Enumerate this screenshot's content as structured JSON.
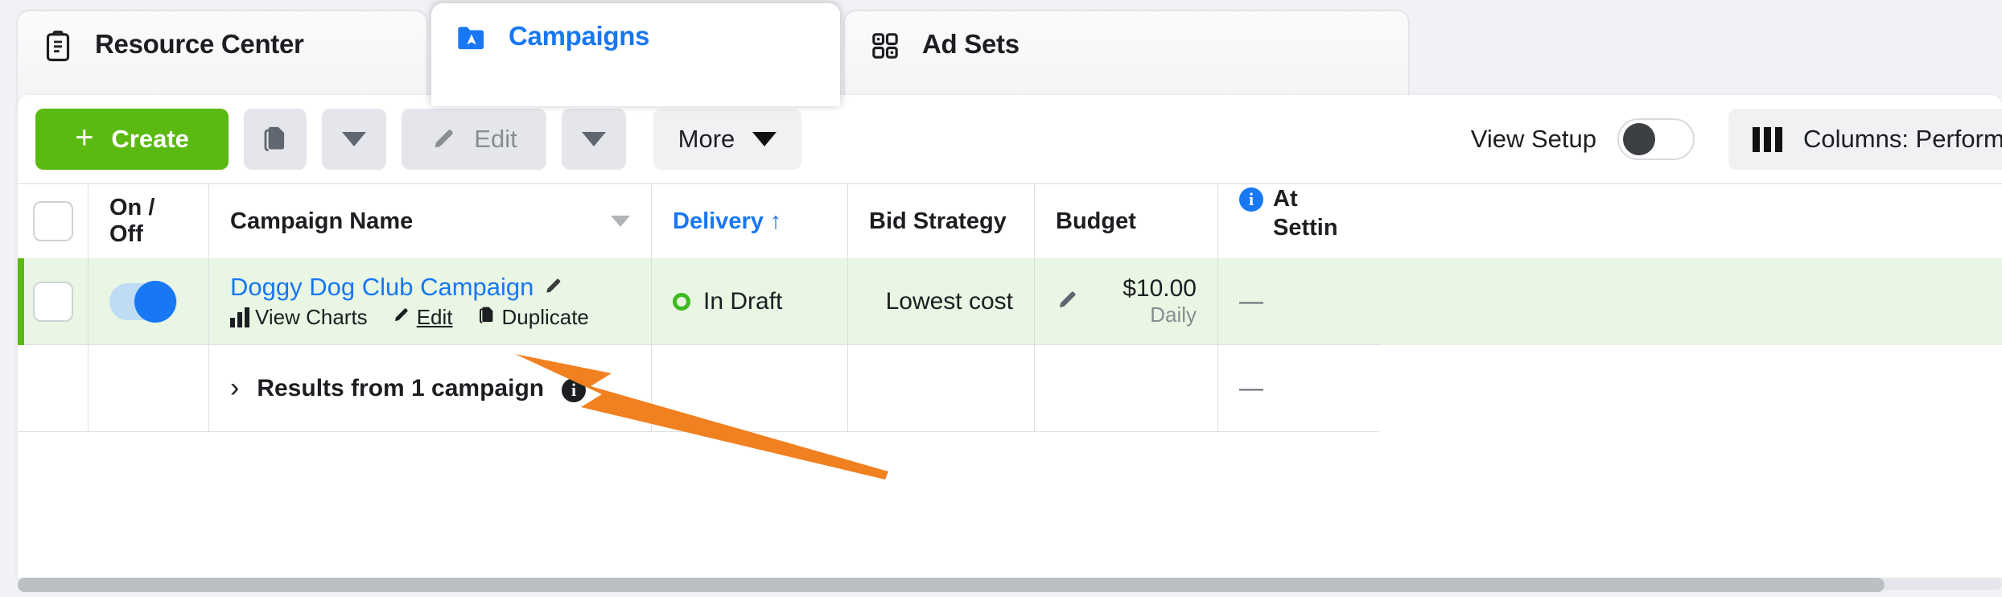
{
  "tabs": [
    {
      "label": "Resource Center",
      "icon": "clipboard-icon",
      "active": false
    },
    {
      "label": "Campaigns",
      "icon": "campaign-folder-icon",
      "active": true
    },
    {
      "label": "Ad Sets",
      "icon": "grid-squares-icon",
      "active": false
    }
  ],
  "toolbar": {
    "create_label": "Create",
    "create_plus": "+",
    "duplicate_icon": "duplicate-icon",
    "duplicate_caret_icon": "chevron-down-icon",
    "edit_label": "Edit",
    "edit_icon": "pencil-icon",
    "edit_caret_icon": "chevron-down-icon",
    "more_label": "More",
    "more_caret_icon": "chevron-down-icon",
    "view_setup_label": "View Setup",
    "view_setup_on": false,
    "columns_label": "Columns: Performance",
    "columns_icon": "columns-icon"
  },
  "table": {
    "headers": {
      "on_off": "On / Off",
      "campaign_name": "Campaign Name",
      "delivery": "Delivery ↑",
      "bid_strategy": "Bid Strategy",
      "budget": "Budget",
      "attribution_line1": "At",
      "attribution_line2": "Settin"
    },
    "row": {
      "toggle_on": true,
      "campaign_name": "Doggy Dog Club Campaign",
      "name_edit_icon": "pencil-icon",
      "actions": [
        {
          "label": "View Charts",
          "icon": "bar-chart-icon"
        },
        {
          "label": "Edit",
          "icon": "pencil-icon"
        },
        {
          "label": "Duplicate",
          "icon": "duplicate-icon"
        }
      ],
      "delivery": "In Draft",
      "delivery_status_icon": "status-ring-icon",
      "bid_strategy": "Lowest cost",
      "budget_edit_icon": "pencil-icon",
      "budget_amount": "$10.00",
      "budget_period": "Daily",
      "attribution": "—"
    },
    "summary": {
      "chevron_icon": "chevron-right-icon",
      "text": "Results from 1 campaign",
      "info_icon": "info-icon",
      "attribution": "—"
    }
  },
  "annotation": {
    "arrow_icon": "orange-arrow-icon",
    "color": "#f08020",
    "points_to": "Edit"
  },
  "colors": {
    "accent_blue": "#1877f2",
    "create_green": "#5bba11",
    "row_highlight": "#e8f6e3",
    "status_green": "#3ebb20",
    "annotation_orange": "#f08020"
  }
}
